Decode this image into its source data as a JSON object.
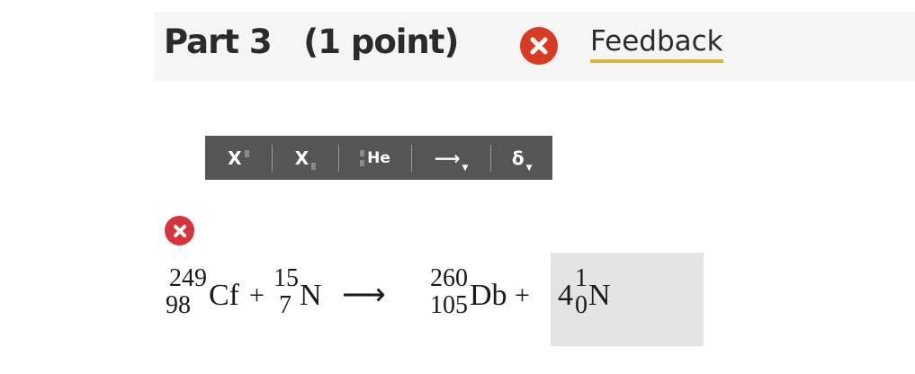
{
  "header": {
    "part_title": "Part 3   (1 point)",
    "feedback_label": "Feedback",
    "feedback_status_color": "#d83a22",
    "feedback_underline_color": "#d4b93f"
  },
  "toolbar": {
    "superscript_label": "X",
    "subscript_label": "X",
    "isotope_label": "He",
    "arrow_label": "⟶",
    "delta_label": "δ",
    "icons": [
      "superscript-icon",
      "subscript-icon",
      "isotope-icon",
      "reaction-arrow-icon",
      "delta-icon"
    ]
  },
  "answer_status": {
    "icon": "incorrect-x-icon",
    "color": "#d8323c"
  },
  "equation": {
    "reactant1": {
      "mass": "249",
      "atomic": "98",
      "symbol": "Cf"
    },
    "plus1": "+",
    "reactant2": {
      "mass": "15",
      "atomic": "7",
      "symbol": "N"
    },
    "arrow": "⟶",
    "product1": {
      "mass": "260",
      "atomic": "105",
      "symbol": "Db"
    },
    "plus2": "+",
    "answer": {
      "coefficient": "4",
      "mass": "1",
      "atomic": "0",
      "symbol": "N"
    }
  }
}
